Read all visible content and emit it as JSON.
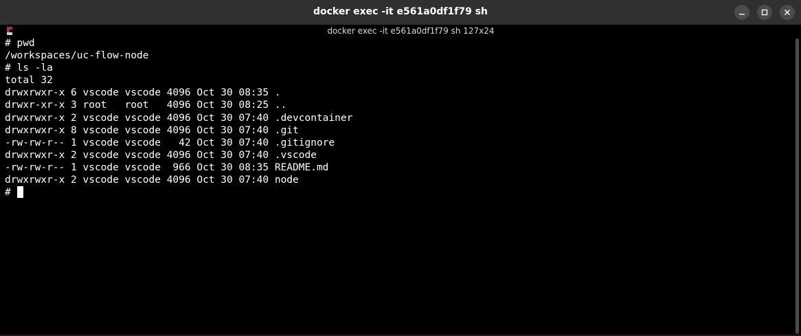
{
  "window": {
    "title": "docker exec -it e561a0df1f79 sh",
    "buttons": {
      "minimize_icon": "minimize-icon",
      "maximize_icon": "maximize-icon",
      "close_icon": "close-icon"
    }
  },
  "tab": {
    "title": "docker exec -it e561a0df1f79 sh 127x24",
    "icon": "terminal-tab-icon"
  },
  "terminal": {
    "lines": [
      "# pwd",
      "/workspaces/uc-flow-node",
      "# ls -la",
      "total 32",
      "drwxrwxr-x 6 vscode vscode 4096 Oct 30 08:35 .",
      "drwxr-xr-x 3 root   root   4096 Oct 30 08:25 ..",
      "drwxrwxr-x 2 vscode vscode 4096 Oct 30 07:40 .devcontainer",
      "drwxrwxr-x 8 vscode vscode 4096 Oct 30 07:40 .git",
      "-rw-rw-r-- 1 vscode vscode   42 Oct 30 07:40 .gitignore",
      "drwxrwxr-x 2 vscode vscode 4096 Oct 30 07:40 .vscode",
      "-rw-rw-r-- 1 vscode vscode  966 Oct 30 08:35 README.md",
      "drwxrwxr-x 2 vscode vscode 4096 Oct 30 07:40 node"
    ],
    "prompt": "#"
  },
  "colors": {
    "titlebar": "#303030",
    "terminal_bg": "#000000",
    "terminal_fg": "#ffffff",
    "desktop_bg": "#2c0f22"
  }
}
